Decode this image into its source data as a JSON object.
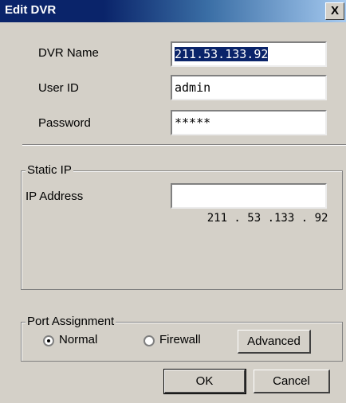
{
  "window": {
    "title": "Edit DVR",
    "close_label": "X"
  },
  "form": {
    "dvr_name": {
      "label": "DVR Name",
      "value": "211.53.133.92"
    },
    "user_id": {
      "label": "User ID",
      "value": "admin"
    },
    "password": {
      "label": "Password",
      "value": "*****"
    }
  },
  "static_ip": {
    "legend": "Static IP",
    "ip_label": "IP Address",
    "ip_value": "211 . 53 .133 . 92"
  },
  "port_assignment": {
    "legend": "Port Assignment",
    "options": [
      {
        "label": "Normal",
        "selected": true
      },
      {
        "label": "Firewall",
        "selected": false
      }
    ],
    "advanced_label": "Advanced"
  },
  "buttons": {
    "ok_label": "OK",
    "cancel_label": "Cancel"
  }
}
